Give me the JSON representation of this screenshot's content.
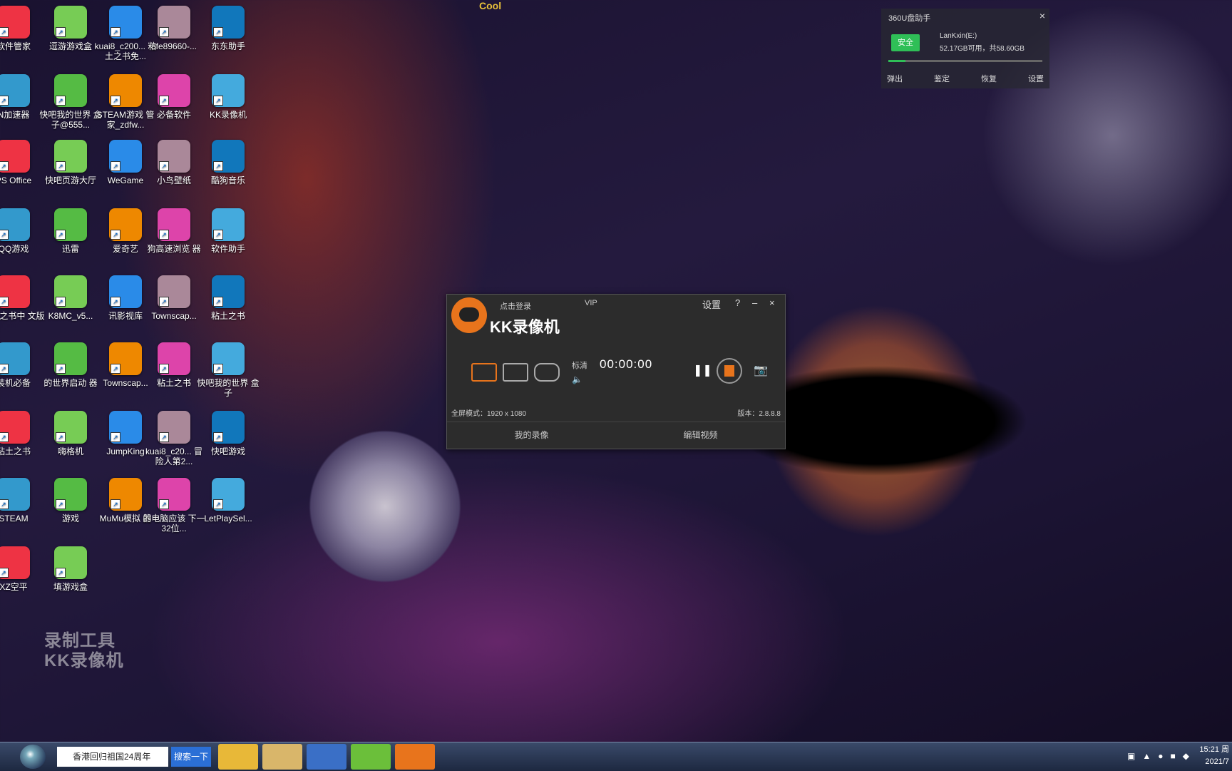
{
  "desktop_icons": [
    {
      "label": "软件管家",
      "x": "软件管家"
    },
    {
      "label": "逗游游戏盒"
    },
    {
      "label": "kuai8_c200... 粘土之书免..."
    },
    {
      "label": "8fe89660-..."
    },
    {
      "label": "东东助手"
    },
    {
      "label": "N加速器"
    },
    {
      "label": "快吧我的世界 盒子@555..."
    },
    {
      "label": "STEAM游戏 管家_zdfw..."
    },
    {
      "label": "必备软件"
    },
    {
      "label": "KK录像机"
    },
    {
      "label": "PS Office"
    },
    {
      "label": "快吧页游大厅"
    },
    {
      "label": "WeGame"
    },
    {
      "label": "小鸟壁纸"
    },
    {
      "label": "酷狗音乐"
    },
    {
      "label": "QQ游戏"
    },
    {
      "label": "迅雷"
    },
    {
      "label": "爱奇艺"
    },
    {
      "label": "狗高速浏览 器"
    },
    {
      "label": "软件助手"
    },
    {
      "label": "粘土之书中 文版"
    },
    {
      "label": "K8MC_v5..."
    },
    {
      "label": "讯影视库"
    },
    {
      "label": "Townscap..."
    },
    {
      "label": "粘土之书"
    },
    {
      "label": "装机必备"
    },
    {
      "label": "的世界启动 器"
    },
    {
      "label": "Townscap..."
    },
    {
      "label": "粘土之书"
    },
    {
      "label": "快吧我的世界 盒子"
    },
    {
      "label": "粘土之书"
    },
    {
      "label": "嗨格机"
    },
    {
      "label": "JumpKing"
    },
    {
      "label": "kuai8_c20... 冒险人第2..."
    },
    {
      "label": "快吧游戏"
    },
    {
      "label": "STEAM"
    },
    {
      "label": "游戏"
    },
    {
      "label": "MuMu模拟 器"
    },
    {
      "label": "的电脑应该 下一32位..."
    },
    {
      "label": "LetPlaySel..."
    },
    {
      "label": "XZ空平"
    },
    {
      "label": "填游戏盒"
    }
  ],
  "watermark": {
    "line1": "录制工具",
    "line2": "KK录像机"
  },
  "panel360": {
    "title": "360U盘助手",
    "safe": "安全",
    "drive": "LanKxin(E:)",
    "space": "52.17GB可用，共58.60GB",
    "usage_fraction": 0.11,
    "actions": [
      "弹出",
      "鉴定",
      "恢复",
      "设置"
    ]
  },
  "kk": {
    "login": "点击登录",
    "vip": "VIP",
    "settings": "设置",
    "help": "?",
    "minimize": "–",
    "close": "×",
    "name": "KK录像机",
    "quality": "标清",
    "volume": "🔈",
    "timer": "00:00:00",
    "mode_text": "全屏模式：1920 x 1080",
    "version": "版本：2.8.8.8",
    "foot_left": "我的录像",
    "foot_right": "编辑视频"
  },
  "taskbar": {
    "search": "香港回归祖国24周年",
    "search_btn": "搜索一下",
    "clock_time": "15:21 周",
    "clock_date": "2021/7"
  },
  "chain_text": "Cool",
  "colors": {
    "accent": "#e8741c",
    "safe": "#2fbf57",
    "taskbar_btn": "#2b6fd6"
  }
}
